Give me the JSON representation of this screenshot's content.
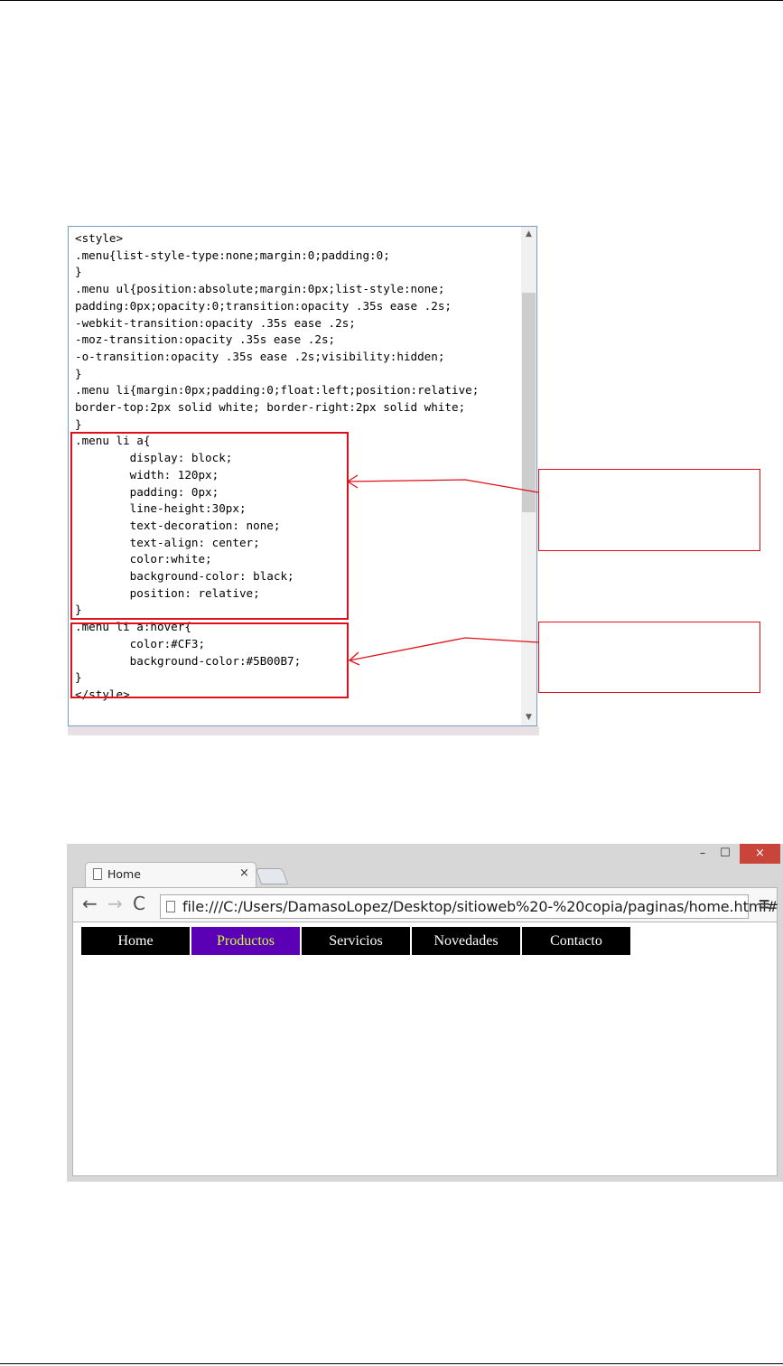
{
  "code_editor": {
    "lines": [
      "<style>",
      ".menu{list-style-type:none;margin:0;padding:0;",
      "}",
      ".menu ul{position:absolute;margin:0px;list-style:none;",
      "padding:0px;opacity:0;transition:opacity .35s ease .2s;",
      "-webkit-transition:opacity .35s ease .2s;",
      "-moz-transition:opacity .35s ease .2s;",
      "-o-transition:opacity .35s ease .2s;visibility:hidden;",
      "}",
      ".menu li{margin:0px;padding:0;float:left;position:relative;",
      "border-top:2px solid white; border-right:2px solid white;",
      "}",
      ".menu li a{",
      "        display: block;",
      "        width: 120px;",
      "        padding: 0px;",
      "        line-height:30px;",
      "        text-decoration: none;",
      "        text-align: center;",
      "        color:white;",
      "        background-color: black;",
      "        position: relative;",
      "}",
      ".menu li a:hover{",
      "        color:#CF3;",
      "        background-color:#5B00B7;",
      "}",
      "</style>"
    ]
  },
  "colors": {
    "highlight_border": "#e0101a",
    "hover_background": "#5B00B7",
    "hover_text": "#CF3"
  },
  "browser": {
    "tab_title": "Home",
    "tab_close": "×",
    "window_controls": {
      "minimize": "–",
      "maximize": "☐",
      "close": "×"
    },
    "nav": {
      "back": "←",
      "forward": "→",
      "reload": "C"
    },
    "url": "file:///C:/Users/DamasoLopez/Desktop/sitioweb%20-%20copia/paginas/home.html#",
    "star": "☆",
    "menu_glyph": "≡",
    "menu_items": [
      {
        "label": "Home",
        "active": false
      },
      {
        "label": "Productos",
        "active": true
      },
      {
        "label": "Servicios",
        "active": false
      },
      {
        "label": "Novedades",
        "active": false
      },
      {
        "label": "Contacto",
        "active": false
      }
    ]
  }
}
